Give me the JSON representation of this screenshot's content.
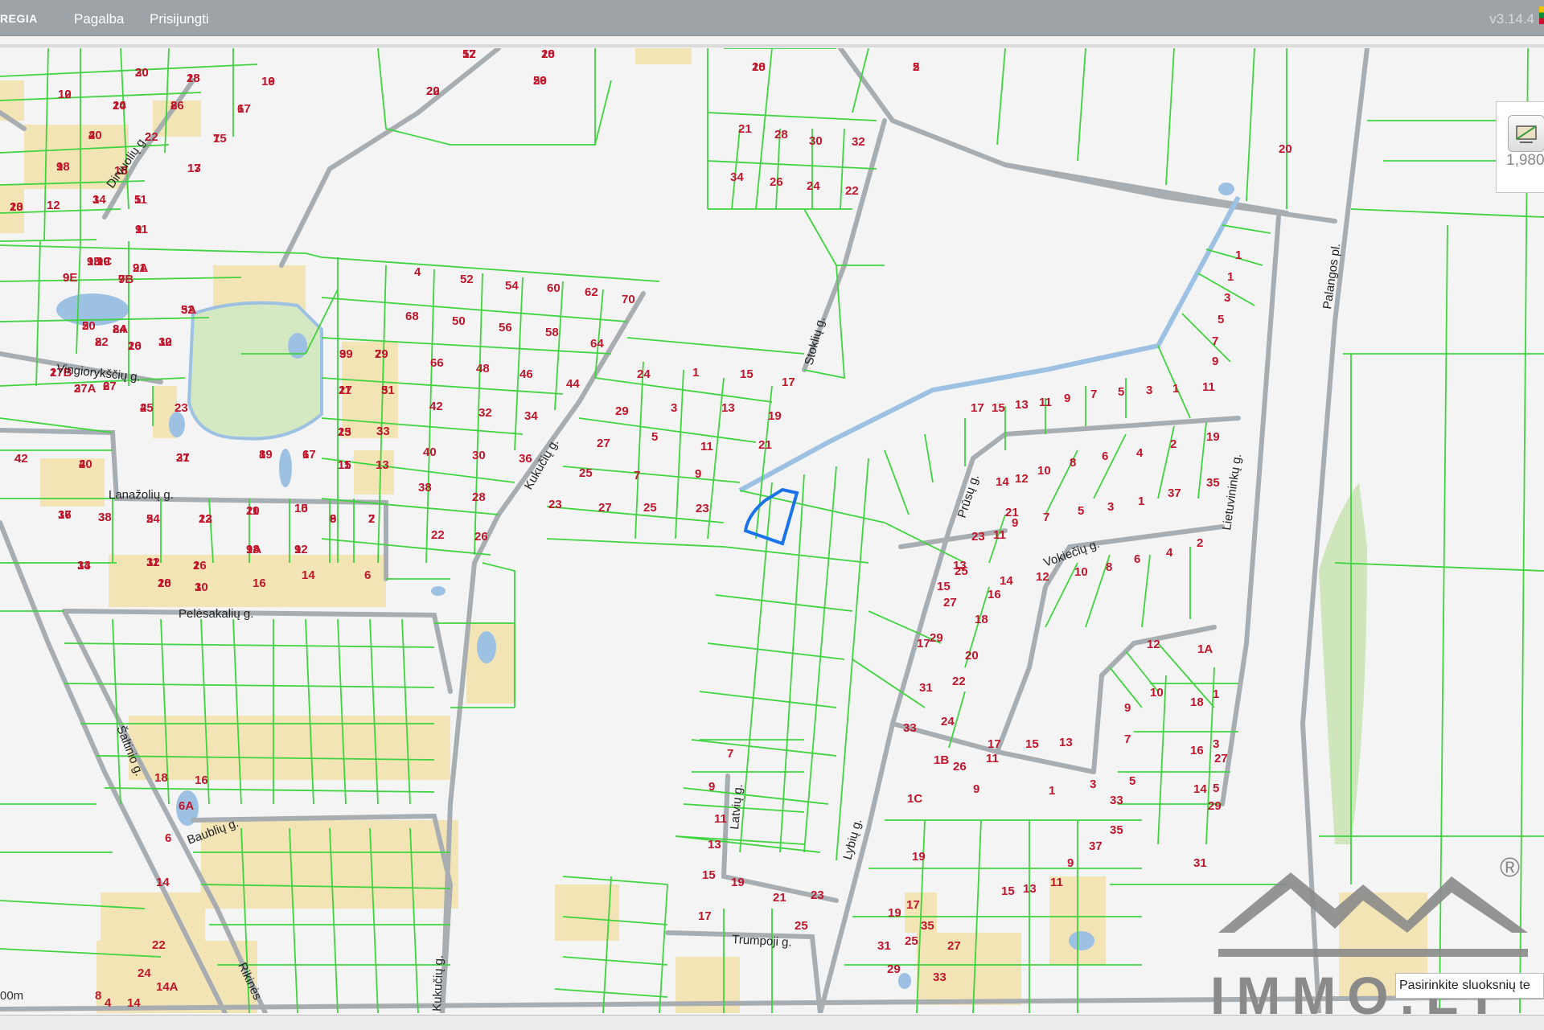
{
  "topbar": {
    "brand": "REGIA",
    "menu": [
      "Pagalba",
      "Prisijungti"
    ],
    "version": "v3.14.4"
  },
  "widget": {
    "icon": "map-layers-icon",
    "scale_text": "1,980"
  },
  "scale_bar": "00m",
  "layer_hint": "Pasirinkite sluoksnių te",
  "logo": {
    "text": "IMMO.LT",
    "reg": "®"
  },
  "colors": {
    "parcel_line": "#3fd43f",
    "road": "#a8adb1",
    "lot_label": "#c0162b",
    "yard": "#f2e4b4",
    "highlight": "#1a73e8",
    "water": "#9cc1e3",
    "park": "#d4e8c2"
  },
  "streets": [
    {
      "id": "dirvuoliu",
      "name": "Dirvuolių g."
    },
    {
      "id": "vingiorykstciu",
      "name": "Vingiorykščių g."
    },
    {
      "id": "lanazoliu",
      "name": "Lanažolių g."
    },
    {
      "id": "kukuciu1",
      "name": "Kukučių g."
    },
    {
      "id": "stokliu",
      "name": "Stoklių g."
    },
    {
      "id": "palangos",
      "name": "Palangos pl."
    },
    {
      "id": "prusu",
      "name": "Prūsų g."
    },
    {
      "id": "lietuvininku",
      "name": "Lietuvininkų g."
    },
    {
      "id": "vokieciu",
      "name": "Vokiečių g."
    },
    {
      "id": "pelesakaliu",
      "name": "Pelėsakalių g."
    },
    {
      "id": "saltinio",
      "name": "Šaltinio g."
    },
    {
      "id": "baubliu",
      "name": "Baublių g."
    },
    {
      "id": "latviu",
      "name": "Latvių g."
    },
    {
      "id": "lybiu",
      "name": "Lybių g."
    },
    {
      "id": "trumpoji",
      "name": "Trumpoji g."
    },
    {
      "id": "kukuciu2",
      "name": "Kukučių g."
    },
    {
      "id": "rikines",
      "name": "Rikinės"
    }
  ],
  "lot_numbers": [
    "57",
    "20",
    "22",
    "59",
    "10",
    "5",
    "30",
    "28",
    "19",
    "10",
    "24",
    "26",
    "17",
    "20",
    "22",
    "15",
    "18",
    "16",
    "13",
    "10",
    "12",
    "14",
    "11",
    "9",
    "9D",
    "9C",
    "9A",
    "9E",
    "9B",
    "32",
    "20",
    "24",
    "22",
    "26",
    "30",
    "27B",
    "27A",
    "27",
    "25",
    "23",
    "21",
    "9",
    "7",
    "11",
    "5",
    "13",
    "3",
    "15",
    "1",
    "19",
    "17",
    "42",
    "40",
    "36",
    "38",
    "24",
    "22",
    "20",
    "10",
    "8",
    "2",
    "18",
    "12",
    "34",
    "32",
    "26",
    "30",
    "28",
    "16",
    "14",
    "6",
    "4",
    "52",
    "54",
    "60",
    "62",
    "70",
    "68",
    "50",
    "56",
    "58",
    "64",
    "66",
    "48",
    "46",
    "44",
    "42",
    "32",
    "34",
    "40",
    "30",
    "36",
    "38",
    "28",
    "22",
    "26",
    "24",
    "1",
    "15",
    "17",
    "29",
    "3",
    "13",
    "19",
    "27",
    "5",
    "11",
    "21",
    "25",
    "7",
    "9",
    "23",
    "27",
    "25",
    "23",
    "21",
    "28",
    "30",
    "32",
    "34",
    "26",
    "24",
    "22",
    "20",
    "1",
    "1",
    "3",
    "5",
    "7",
    "9",
    "11",
    "1",
    "3",
    "5",
    "7",
    "9",
    "11",
    "13",
    "15",
    "17",
    "19",
    "2",
    "4",
    "6",
    "8",
    "10",
    "12",
    "14",
    "21",
    "23",
    "25",
    "27",
    "29",
    "31",
    "33",
    "35",
    "37",
    "1",
    "3",
    "5",
    "7",
    "9",
    "11",
    "13",
    "15",
    "17",
    "19",
    "2",
    "4",
    "6",
    "8",
    "10",
    "12",
    "14",
    "16",
    "18",
    "20",
    "22",
    "24",
    "26",
    "1C",
    "1B",
    "1A",
    "18",
    "16",
    "14",
    "12",
    "10",
    "9",
    "7",
    "5",
    "3",
    "1",
    "17",
    "15",
    "13",
    "11",
    "9",
    "1",
    "3",
    "5",
    "7",
    "9",
    "11",
    "13",
    "15",
    "17",
    "19",
    "21",
    "23",
    "25",
    "27",
    "29",
    "31",
    "33",
    "35",
    "37",
    "9",
    "11",
    "13",
    "15",
    "17",
    "19",
    "25",
    "27",
    "33",
    "31",
    "29",
    "35",
    "18",
    "16",
    "6A",
    "6",
    "14",
    "22",
    "24",
    "14A",
    "14",
    "8",
    "4",
    "12",
    "18",
    "20",
    "26",
    "28",
    "2",
    "20",
    "18",
    "16",
    "12",
    "10",
    "8",
    "6",
    "4",
    "2",
    "7",
    "9",
    "15",
    "17",
    "23",
    "1",
    "3",
    "5",
    "11",
    "13",
    "19",
    "21",
    "9",
    "7",
    "5A",
    "5",
    "8A",
    "8",
    "10",
    "12",
    "1",
    "3",
    "6",
    "4",
    "2",
    "37",
    "39",
    "29",
    "27",
    "31",
    "25",
    "33",
    "11",
    "13",
    "8",
    "6",
    "4",
    "2",
    "17",
    "3",
    "5",
    "13",
    "11",
    "15",
    "9",
    "7",
    "9A",
    "9",
    "13",
    "11",
    "1",
    "1",
    "10"
  ]
}
